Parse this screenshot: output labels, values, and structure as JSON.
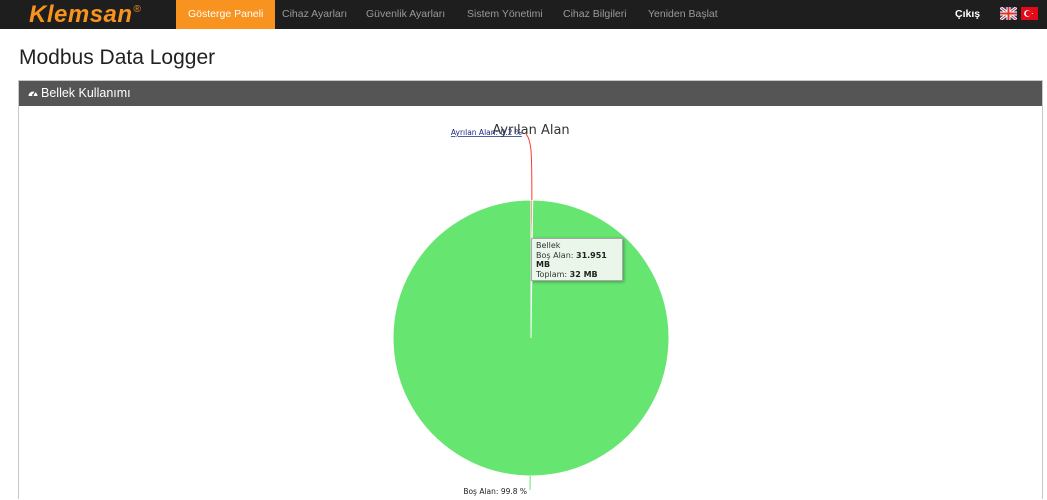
{
  "brand": {
    "name": "Klemsan",
    "mark": "®"
  },
  "nav": {
    "items": [
      {
        "label": "Gösterge Paneli",
        "active": true
      },
      {
        "label": "Cihaz Ayarları",
        "active": false
      },
      {
        "label": "Güvenlik Ayarları",
        "active": false
      },
      {
        "label": "Sistem Yönetimi",
        "active": false
      },
      {
        "label": "Cihaz Bilgileri",
        "active": false
      },
      {
        "label": "Yeniden Başlat",
        "active": false
      }
    ],
    "logout_label": "Çıkış",
    "language_flags": [
      "uk-flag-icon",
      "turkey-flag-icon"
    ]
  },
  "page": {
    "title": "Modbus Data Logger"
  },
  "panel": {
    "title": "Bellek Kullanımı",
    "icon": "dashboard-icon"
  },
  "tooltip": {
    "series": "Bellek",
    "line1_label": "Boş Alan: ",
    "line1_value": "31.951 MB",
    "line2_label": "Toplam: ",
    "line2_value": "32 MB"
  },
  "colors": {
    "accent": "#f7931e",
    "free": "#66e571",
    "used": "#ff3b2f",
    "navbar": "#1e1e1e",
    "panel_header": "#555555"
  },
  "chart_data": {
    "type": "pie",
    "title": "Ayrılan Alan",
    "slices": [
      {
        "name": "Ayrılan Alan",
        "value": 0.2,
        "unit": "%",
        "label": "Ayrılan Alan: 0.2 %",
        "color": "#ff3b2f"
      },
      {
        "name": "Boş Alan",
        "value": 99.8,
        "unit": "%",
        "label": "Boş Alan: 99.8 %",
        "color": "#66e571"
      }
    ]
  }
}
